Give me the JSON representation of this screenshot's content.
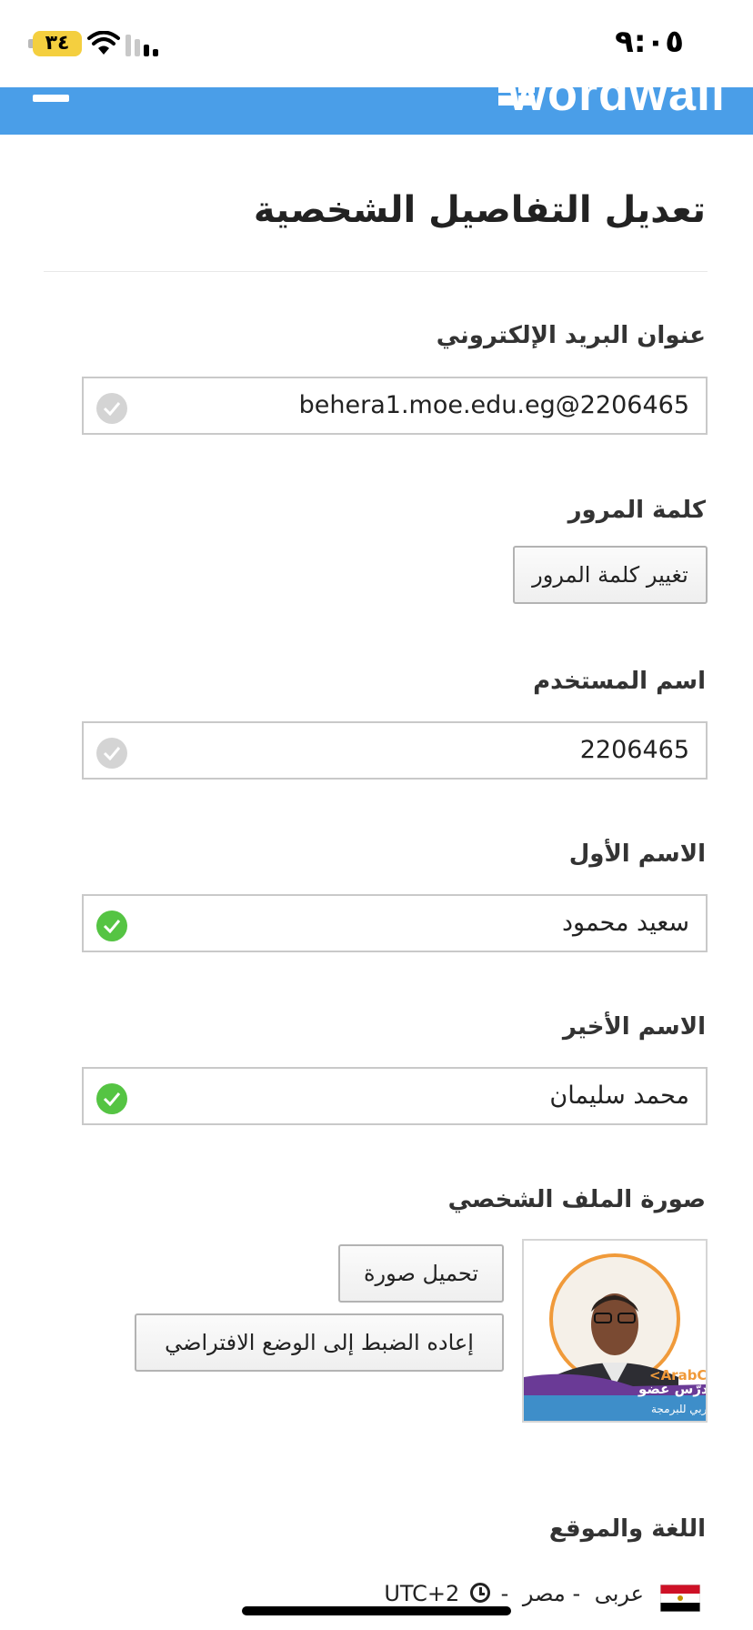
{
  "status_bar": {
    "time": "٩:٠٥",
    "battery": "٣٤"
  },
  "header": {
    "logo": "wordwall"
  },
  "page": {
    "title": "تعديل التفاصيل الشخصية"
  },
  "email": {
    "label": "عنوان البريد الإلكتروني",
    "value": "behera1.moe.edu.eg@2206465"
  },
  "password": {
    "label": "كلمة المرور",
    "button": "تغيير كلمة المرور"
  },
  "username": {
    "label": "اسم المستخدم",
    "value": "2206465"
  },
  "first_name": {
    "label": "الاسم الأول",
    "value": "سعيد محمود"
  },
  "last_name": {
    "label": "الاسم الأخير",
    "value": "محمد سليمان"
  },
  "profile_picture": {
    "label": "صورة الملف الشخصي",
    "upload_button": "تحميل صورة",
    "reset_button": "إعاده الضبط إلى الوضع الافتراضي",
    "badge_title": "مدرّس عضو",
    "badge_subtitle": "الأسبوع العربي للبرمجة",
    "badge_corner": "<ArabC Week"
  },
  "language_location": {
    "label": "اللغة والموقع",
    "country": "مصر",
    "separator": "-",
    "language": "عربى",
    "timezone": "UTC+2"
  },
  "colors": {
    "header": "#4a9ee8",
    "check_valid": "#55c443",
    "check_neutral": "#d4d4d4"
  }
}
